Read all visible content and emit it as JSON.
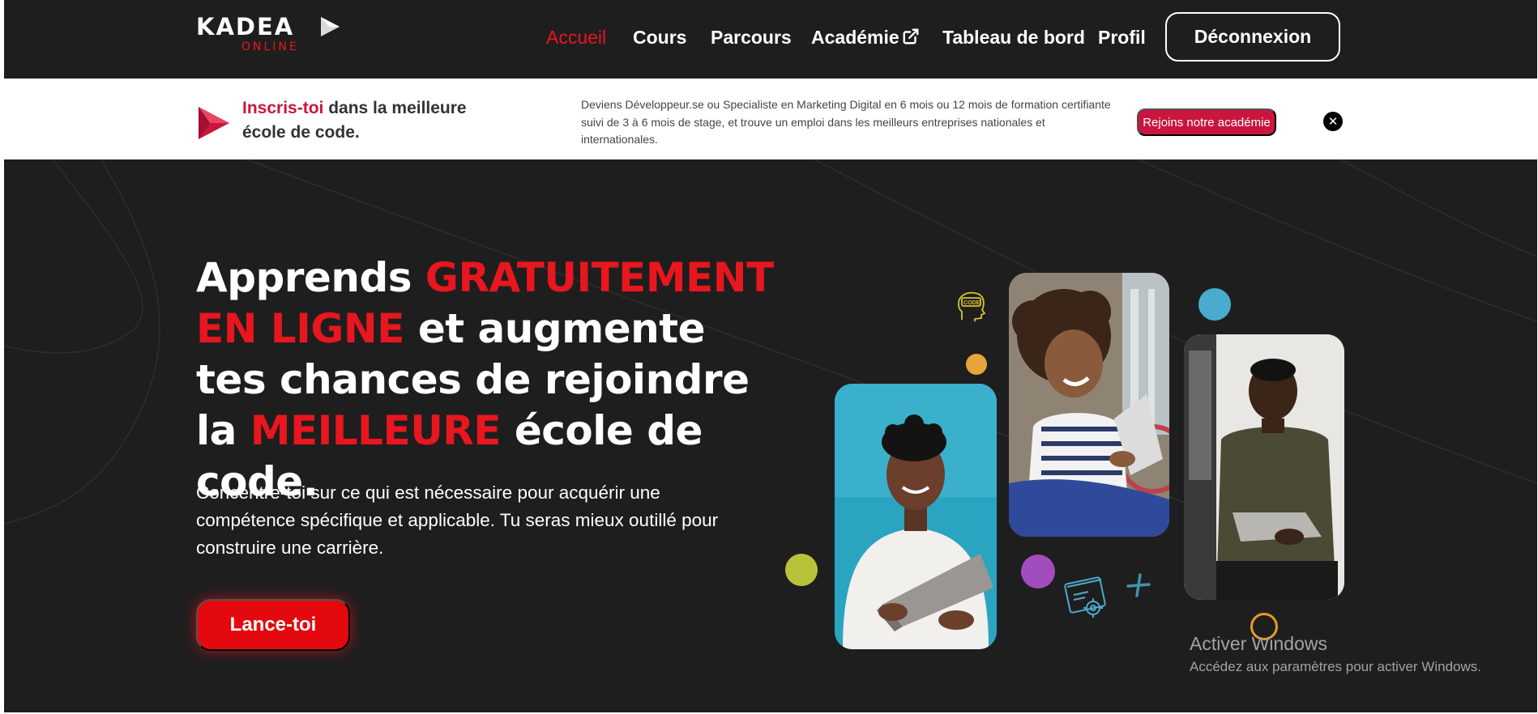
{
  "brand": {
    "name": "KADEA",
    "sub": "ONLINE"
  },
  "nav": {
    "items": [
      {
        "label": "Accueil",
        "active": true
      },
      {
        "label": "Cours",
        "active": false
      },
      {
        "label": "Parcours",
        "active": false
      },
      {
        "label": "Académie",
        "active": false,
        "external": true
      },
      {
        "label": "Tableau de bord",
        "active": false
      },
      {
        "label": "Profil",
        "active": false
      }
    ],
    "logout_label": "Déconnexion"
  },
  "banner": {
    "title_highlight": "Inscris-toi",
    "title_rest": " dans la meilleure école de code.",
    "text": "Deviens Développeur.se ou Specialiste en Marketing Digital en 6 mois ou 12 mois de formation certifiante suivi de 3 à 6 mois de stage, et trouve un emploi dans les meilleurs entreprises nationales et internationales.",
    "button_label": "Rejoins notre académie",
    "close_symbol": "✕"
  },
  "hero": {
    "title_parts": {
      "p1": "Apprends ",
      "p2": "GRATUITEMENT EN LIGNE",
      "p3": " et augmente tes chances de rejoindre la ",
      "p4": "MEILLEURE",
      "p5": " école de code."
    },
    "description": "Concentre-toi sur ce qui est nécessaire pour acquérir une compétence spécifique et applicable. Tu seras mieux outillé pour construire une carrière.",
    "cta_label": "Lance-toi",
    "badge_text": "CODE"
  },
  "watermark": {
    "title": "Activer Windows",
    "subtitle": "Accédez aux paramètres pour activer Windows."
  },
  "colors": {
    "accent_red": "#e8161e",
    "banner_red": "#c8163f",
    "background_dark": "#1f1e1f",
    "dot_yellow": "#e8a33a",
    "dot_blue": "#4aaccd",
    "dot_green": "#b8c33a",
    "dot_purple": "#a24dbd",
    "ring_orange": "#e69a1e"
  }
}
